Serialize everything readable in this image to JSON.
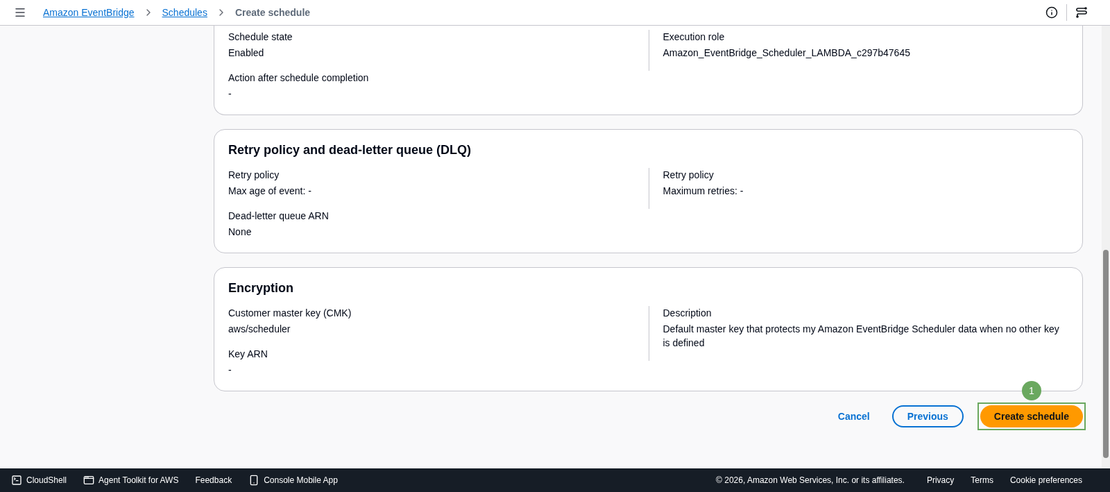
{
  "breadcrumbs": [
    {
      "label": "Amazon EventBridge",
      "kind": "link"
    },
    {
      "label": "Schedules",
      "kind": "link"
    },
    {
      "label": "Create schedule",
      "kind": "current"
    }
  ],
  "sections": [
    {
      "left": [
        {
          "label": "Schedule state",
          "value": "Enabled"
        },
        {
          "label": "Action after schedule completion",
          "value": "-"
        }
      ],
      "right": [
        {
          "label": "Execution role",
          "value": "Amazon_EventBridge_Scheduler_LAMBDA_c297b47645"
        }
      ]
    },
    {
      "title": "Retry policy and dead-letter queue (DLQ)",
      "left": [
        {
          "label": "Retry policy",
          "value": "Max age of event: -"
        },
        {
          "label": "Dead-letter queue ARN",
          "value": "None"
        }
      ],
      "right": [
        {
          "label": "Retry policy",
          "value": "Maximum retries: -"
        }
      ]
    },
    {
      "title": "Encryption",
      "left": [
        {
          "label": "Customer master key (CMK)",
          "value": "aws/scheduler"
        },
        {
          "label": "Key ARN",
          "value": "-"
        }
      ],
      "right": [
        {
          "label": "Description",
          "value": "Default master key that protects my Amazon EventBridge Scheduler data when no other key is defined"
        }
      ]
    }
  ],
  "actions": {
    "cancel": "Cancel",
    "previous": "Previous",
    "primary": "Create schedule",
    "step_marker": "1"
  },
  "footer": {
    "left": [
      {
        "label": "CloudShell",
        "kind": "terminal"
      },
      {
        "label": "Agent Toolkit for AWS",
        "kind": "window"
      },
      {
        "label": "Feedback",
        "kind": "plain"
      },
      {
        "label": "Console Mobile App",
        "kind": "phone"
      }
    ],
    "copyright": "© 2026, Amazon Web Services, Inc. or its affiliates.",
    "links": [
      "Privacy",
      "Terms",
      "Cookie preferences"
    ]
  }
}
